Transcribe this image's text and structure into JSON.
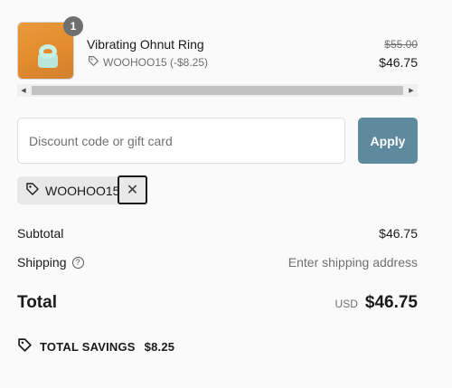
{
  "line_item": {
    "quantity": "1",
    "name": "Vibrating Ohnut Ring",
    "discount_label": "WOOHOO15 (-$8.25)",
    "original_price": "$55.00",
    "final_price": "$46.75"
  },
  "discount": {
    "placeholder": "Discount code or gift card",
    "apply_label": "Apply",
    "applied_code": "WOOHOO15"
  },
  "summary": {
    "subtotal_label": "Subtotal",
    "subtotal_value": "$46.75",
    "shipping_label": "Shipping",
    "shipping_value": "Enter shipping address",
    "total_label": "Total",
    "currency": "USD",
    "total_value": "$46.75"
  },
  "savings": {
    "label": "TOTAL SAVINGS",
    "amount": "$8.25"
  },
  "colors": {
    "apply_button": "#5f8a9e",
    "background": "#fafafa"
  }
}
